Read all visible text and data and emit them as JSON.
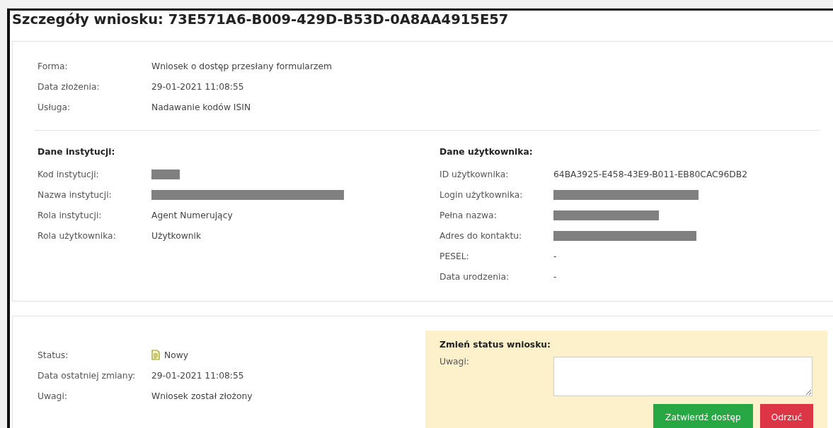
{
  "page": {
    "title": "Szczegóły wniosku: 73E571A6-B009-429D-B53D-0A8AA4915E57"
  },
  "request": [
    {
      "label": "Forma:",
      "value": "Wniosek o dostęp przesłany formularzem"
    },
    {
      "label": "Data złożenia:",
      "value": "29-01-2021 11:08:55"
    },
    {
      "label": "Usługa:",
      "value": "Nadawanie kodów ISIN"
    }
  ],
  "institution": {
    "heading": "Dane instytucji:",
    "fields": [
      {
        "label": "Kod instytucji:",
        "redacted": true
      },
      {
        "label": "Nazwa instytucji:",
        "redacted": true
      },
      {
        "label": "Rola instytucji:",
        "value": "Agent Numerujący"
      },
      {
        "label": "Rola użytkownika:",
        "value": "Użytkownik"
      }
    ]
  },
  "user": {
    "heading": "Dane użytkownika:",
    "fields": [
      {
        "label": "ID użytkownika:",
        "value": "64BA3925-E458-43E9-B011-EB80CAC96DB2"
      },
      {
        "label": "Login użytkownika:",
        "redacted": true
      },
      {
        "label": "Pełna nazwa:",
        "redacted": true
      },
      {
        "label": "Adres do kontaktu:",
        "redacted": true
      },
      {
        "label": "PESEL:",
        "value": "-"
      },
      {
        "label": "Data urodzenia:",
        "value": "-"
      }
    ]
  },
  "status": [
    {
      "label": "Status:",
      "value": "Nowy",
      "kind": "status"
    },
    {
      "label": "Data ostatniej zmiany:",
      "value": "29-01-2021 11:08:55",
      "kind": "text"
    },
    {
      "label": "Uwagi:",
      "value": "Wniosek został złożony",
      "kind": "text"
    }
  ],
  "change_status": {
    "heading": "Zmień status wniosku:",
    "notes_label": "Uwagi:",
    "buttons": [
      {
        "label": "Zatwierdź dostęp",
        "kind": "approve"
      },
      {
        "label": "Odrzuć",
        "kind": "reject"
      }
    ]
  }
}
